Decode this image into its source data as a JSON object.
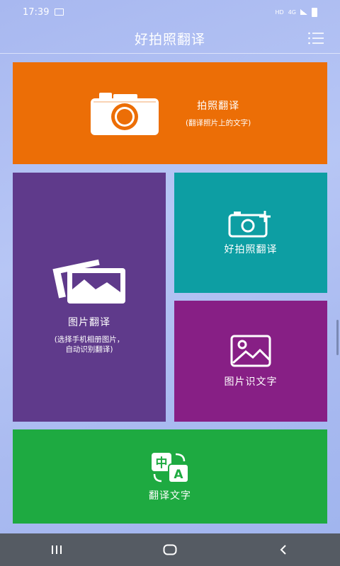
{
  "status": {
    "time": "17:39",
    "network": "HD",
    "signal": "4G"
  },
  "header": {
    "title": "好拍照翻译",
    "menu_icon": "list-menu-icon"
  },
  "tiles": {
    "photo_translate": {
      "label": "拍照翻译",
      "sub": "(翻译照片上的文字)",
      "icon": "camera-icon",
      "color": "#ec6e06"
    },
    "image_translate": {
      "label": "图片翻译",
      "sub_line1": "(选择手机相册图片，",
      "sub_line2": "自动识别翻译)",
      "icon": "photos-icon",
      "color": "#5f3a8b"
    },
    "good_photo": {
      "label": "好拍照翻译",
      "icon": "camera-plus-icon",
      "color": "#0d9ea3"
    },
    "image_ocr": {
      "label": "图片识文字",
      "icon": "image-icon",
      "color": "#871f85"
    },
    "text_translate": {
      "label": "翻译文字",
      "icon": "translate-icon",
      "icon_text_zh": "中",
      "icon_text_en": "A",
      "color": "#1eaa41"
    }
  },
  "navigation": {
    "recent": "recent-apps-icon",
    "home": "home-icon",
    "back": "back-icon"
  }
}
